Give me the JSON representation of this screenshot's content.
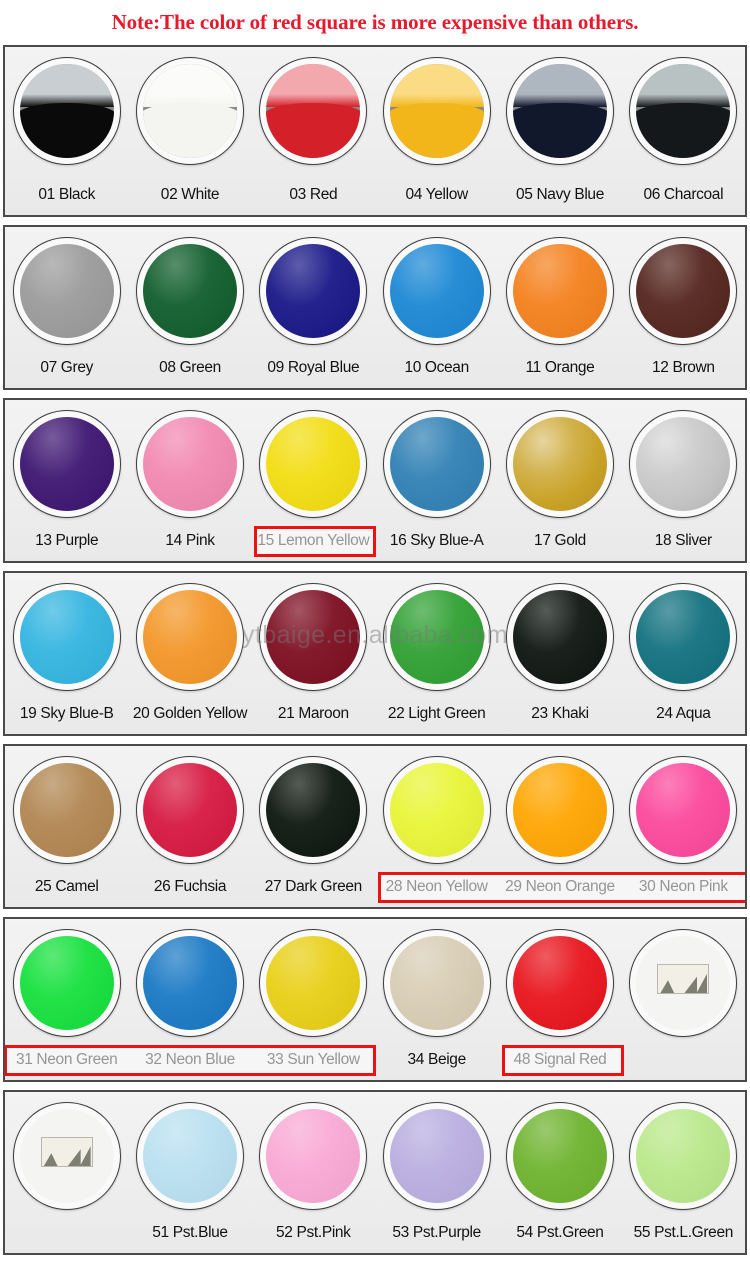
{
  "header": {
    "note": "Note:The color of red square is more expensive than others."
  },
  "watermark": {
    "text": "ytbaige.en.alibaba.com"
  },
  "colors": {
    "note_red": "#e8192c",
    "highlight_red": "#ee1111",
    "panel_background": "#efefef",
    "panel_border": "#4a4a4a",
    "label_text": "#121212"
  },
  "rows": [
    {
      "row_index": 1,
      "style": "photo",
      "items": [
        {
          "code": "01",
          "name": "Black",
          "label": "01 Black",
          "hex": "#0a0a0a",
          "top_hex": "#c9ced2"
        },
        {
          "code": "02",
          "name": "White",
          "label": "02 White",
          "hex": "#f4f4f0",
          "top_hex": "#fbfbf9"
        },
        {
          "code": "03",
          "name": "Red",
          "label": "03 Red",
          "hex": "#d42028",
          "top_hex": "#f3a8ae"
        },
        {
          "code": "04",
          "name": "Yellow",
          "label": "04 Yellow",
          "hex": "#f2b61b",
          "top_hex": "#fbdc84"
        },
        {
          "code": "05",
          "name": "Navy Blue",
          "label": "05 Navy Blue",
          "hex": "#12182c",
          "top_hex": "#aeb6bf"
        },
        {
          "code": "06",
          "name": "Charcoal",
          "label": "06 Charcoal",
          "hex": "#14181a",
          "top_hex": "#b9c2c2"
        }
      ]
    },
    {
      "row_index": 2,
      "style": "flat",
      "items": [
        {
          "code": "07",
          "name": "Grey",
          "label": "07 Grey",
          "hex": "#9a9a9a"
        },
        {
          "code": "08",
          "name": "Green",
          "label": "08 Green",
          "hex": "#0e5c2b"
        },
        {
          "code": "09",
          "name": "Royal Blue",
          "label": "09 Royal Blue",
          "hex": "#171687"
        },
        {
          "code": "10",
          "name": "Ocean",
          "label": "10 Ocean",
          "hex": "#1a87d4"
        },
        {
          "code": "11",
          "name": "Orange",
          "label": "11 Orange",
          "hex": "#f4801c"
        },
        {
          "code": "12",
          "name": "Brown",
          "label": "12 Brown",
          "hex": "#53231c"
        }
      ]
    },
    {
      "row_index": 3,
      "style": "flat",
      "items": [
        {
          "code": "13",
          "name": "Purple",
          "label": "13 Purple",
          "hex": "#3c1470"
        },
        {
          "code": "14",
          "name": "Pink",
          "label": "14 Pink",
          "hex": "#f287b0"
        },
        {
          "code": "15",
          "name": "Lemon Yellow",
          "label": "15 Lemon Yellow",
          "hex": "#f2dd10",
          "highlighted": true
        },
        {
          "code": "16",
          "name": "Sky Blue-A",
          "label": "16 Sky Blue-A",
          "hex": "#2f80b4"
        },
        {
          "code": "17",
          "name": "Gold",
          "label": "17 Gold",
          "hex": "#c9a227",
          "metallic": true
        },
        {
          "code": "18",
          "name": "Sliver",
          "label": "18 Sliver",
          "hex": "#c4c4c4",
          "metallic": true
        }
      ]
    },
    {
      "row_index": 4,
      "style": "flat",
      "items": [
        {
          "code": "19",
          "name": "Sky Blue-B",
          "label": "19 Sky Blue-B",
          "hex": "#32b4e0"
        },
        {
          "code": "20",
          "name": "Golden Yellow",
          "label": "20 Golden Yellow",
          "hex": "#f39627"
        },
        {
          "code": "21",
          "name": "Maroon",
          "label": "21 Maroon",
          "hex": "#7c0d20"
        },
        {
          "code": "22",
          "name": "Light Green",
          "label": "22 Light Green",
          "hex": "#2fa032"
        },
        {
          "code": "23",
          "name": "Khaki",
          "label": "23 Khaki",
          "hex": "#0d1410"
        },
        {
          "code": "24",
          "name": "Aqua",
          "label": "24 Aqua",
          "hex": "#10707e"
        }
      ]
    },
    {
      "row_index": 5,
      "style": "flat",
      "items": [
        {
          "code": "25",
          "name": "Camel",
          "label": "25 Camel",
          "hex": "#b08550"
        },
        {
          "code": "26",
          "name": "Fuchsia",
          "label": "26 Fuchsia",
          "hex": "#d6173f"
        },
        {
          "code": "27",
          "name": "Dark Green",
          "label": "27 Dark Green",
          "hex": "#0b150d"
        },
        {
          "code": "28",
          "name": "Neon Yellow",
          "label": "28 Neon Yellow",
          "hex": "#e8f535",
          "highlighted": true
        },
        {
          "code": "29",
          "name": "Neon Orange",
          "label": "29 Neon Orange",
          "hex": "#ffa500",
          "highlighted": true
        },
        {
          "code": "30",
          "name": "Neon Pink",
          "label": "30 Neon Pink",
          "hex": "#fb479b",
          "highlighted": true
        }
      ]
    },
    {
      "row_index": 6,
      "style": "flat",
      "items": [
        {
          "code": "31",
          "name": "Neon Green",
          "label": "31 Neon Green",
          "hex": "#14e03c",
          "highlighted": true
        },
        {
          "code": "32",
          "name": "Neon Blue",
          "label": "32 Neon Blue",
          "hex": "#1878c4",
          "highlighted": true
        },
        {
          "code": "33",
          "name": "Sun Yellow",
          "label": "33 Sun Yellow",
          "hex": "#e8cf14",
          "highlighted": true
        },
        {
          "code": "34",
          "name": "Beige",
          "label": "34 Beige",
          "hex": "#d8cdb4"
        },
        {
          "code": "48",
          "name": "Signal Red",
          "label": "48 Signal Red",
          "hex": "#e8131c",
          "highlighted": true
        },
        {
          "code": "",
          "name": "",
          "label": "",
          "hex": "",
          "empty": true
        }
      ]
    },
    {
      "row_index": 7,
      "style": "flat",
      "items": [
        {
          "code": "",
          "name": "",
          "label": "",
          "hex": "",
          "empty": true
        },
        {
          "code": "51",
          "name": "Pst.Blue",
          "label": "51 Pst.Blue",
          "hex": "#b9e0f0"
        },
        {
          "code": "52",
          "name": "Pst.Pink",
          "label": "52 Pst.Pink",
          "hex": "#f9a8d4"
        },
        {
          "code": "53",
          "name": "Pst.Purple",
          "label": "53 Pst.Purple",
          "hex": "#b9aee0"
        },
        {
          "code": "54",
          "name": "Pst.Green",
          "label": "54 Pst.Green",
          "hex": "#6db32e"
        },
        {
          "code": "55",
          "name": "Pst.L.Green",
          "label": "55 Pst.L.Green",
          "hex": "#b9e88a"
        }
      ]
    }
  ],
  "highlight_boxes": [
    {
      "row": 3,
      "start": 2,
      "end": 2,
      "label": "15 Lemon Yellow"
    },
    {
      "row": 5,
      "start": 3,
      "end": 5,
      "label": "28 Neon Yellow / 29 Neon Orange / 30 Neon Pink"
    },
    {
      "row": 6,
      "start": 0,
      "end": 2,
      "label": "31 Neon Green / 32 Neon Blue / 33 Sun Yellow"
    },
    {
      "row": 6,
      "start": 4,
      "end": 4,
      "label": "48 Signal Red"
    }
  ]
}
